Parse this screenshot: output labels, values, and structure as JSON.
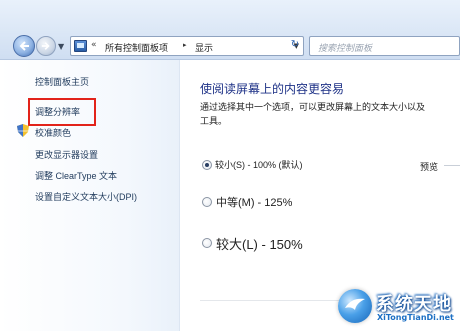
{
  "address_bar": {
    "breadcrumb_prefix": "«",
    "crumbs": [
      "所有控制面板项",
      "显示"
    ],
    "separator": "▸",
    "dropdown": "▼",
    "refresh_glyph": "↻"
  },
  "search": {
    "placeholder": "搜索控制面板"
  },
  "sidebar": {
    "items": [
      {
        "label": "控制面板主页"
      },
      {
        "label": "调整分辨率"
      },
      {
        "label": "校准颜色"
      },
      {
        "label": "更改显示器设置"
      },
      {
        "label": "调整 ClearType 文本"
      },
      {
        "label": "设置自定义文本大小(DPI)"
      }
    ]
  },
  "main": {
    "title": "使阅读屏幕上的内容更容易",
    "description": "通过选择其中一个选项，可以更改屏幕上的文本大小以及其他项，请单击\"应用\"。若要暂时放大屏幕的部分区域，请使用放大镜工具。",
    "description_line1": "通过选择其中一个选项，可以更改屏幕上的文本大小以及",
    "description_line2": "工具。",
    "options": [
      {
        "label": "较小(S) - 100% (默认)",
        "selected": true
      },
      {
        "label": "中等(M) - 125%",
        "selected": false
      },
      {
        "label": "较大(L) - 150%",
        "selected": false
      }
    ],
    "preview_label": "预览"
  },
  "watermark": {
    "title": "系统天地",
    "url": "XiTongTianDi.net"
  },
  "colors": {
    "title": "#1e3287",
    "link": "#1e395b",
    "highlight": "#e2231a",
    "watermark": "#1c6fc4"
  }
}
